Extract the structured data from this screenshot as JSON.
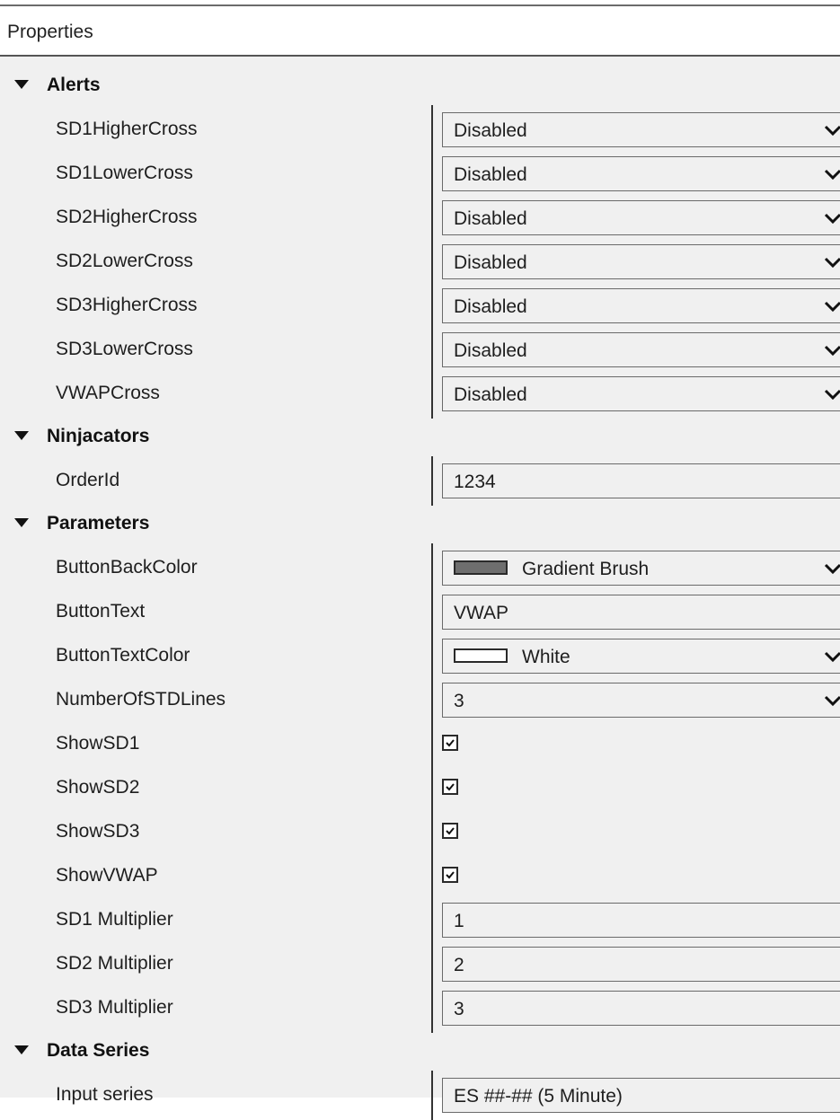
{
  "panel": {
    "title": "Properties"
  },
  "categories": [
    {
      "label": "Alerts",
      "rows": [
        {
          "name": "SD1HigherCross",
          "type": "dropdown",
          "value": "Disabled"
        },
        {
          "name": "SD1LowerCross",
          "type": "dropdown",
          "value": "Disabled"
        },
        {
          "name": "SD2HigherCross",
          "type": "dropdown",
          "value": "Disabled"
        },
        {
          "name": "SD2LowerCross",
          "type": "dropdown",
          "value": "Disabled"
        },
        {
          "name": "SD3HigherCross",
          "type": "dropdown",
          "value": "Disabled"
        },
        {
          "name": "SD3LowerCross",
          "type": "dropdown",
          "value": "Disabled"
        },
        {
          "name": "VWAPCross",
          "type": "dropdown",
          "value": "Disabled"
        }
      ]
    },
    {
      "label": "Ninjacators",
      "rows": [
        {
          "name": "OrderId",
          "type": "text",
          "value": "1234"
        }
      ]
    },
    {
      "label": "Parameters",
      "rows": [
        {
          "name": "ButtonBackColor",
          "type": "color-dropdown",
          "value": "Gradient Brush",
          "swatch": "#6e6e6e"
        },
        {
          "name": "ButtonText",
          "type": "text",
          "value": "VWAP"
        },
        {
          "name": "ButtonTextColor",
          "type": "color-dropdown",
          "value": "White",
          "swatch": "#ffffff"
        },
        {
          "name": "NumberOfSTDLines",
          "type": "dropdown",
          "value": "3"
        },
        {
          "name": "ShowSD1",
          "type": "checkbox",
          "checked": true
        },
        {
          "name": "ShowSD2",
          "type": "checkbox",
          "checked": true
        },
        {
          "name": "ShowSD3",
          "type": "checkbox",
          "checked": true
        },
        {
          "name": "ShowVWAP",
          "type": "checkbox",
          "checked": true
        },
        {
          "name": "SD1 Multiplier",
          "type": "text",
          "value": "1"
        },
        {
          "name": "SD2 Multiplier",
          "type": "text",
          "value": "2"
        },
        {
          "name": "SD3 Multiplier",
          "type": "text",
          "value": "3"
        }
      ]
    },
    {
      "label": "Data Series",
      "rows": [
        {
          "name": "Input series",
          "type": "text",
          "value": "ES ##-## (5 Minute)"
        }
      ]
    }
  ],
  "colors": {
    "background": "#f0f0f0",
    "border": "#6a6a6a",
    "text": "#1e1e1e"
  }
}
